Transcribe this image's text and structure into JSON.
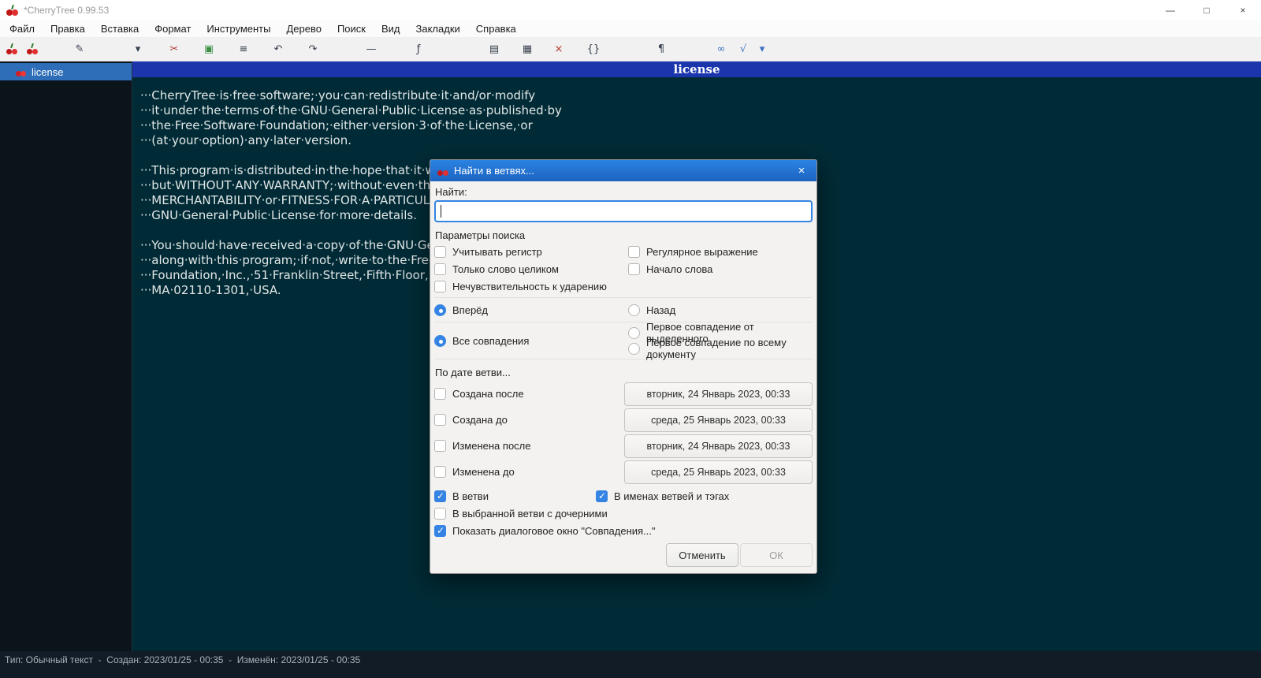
{
  "colors": {
    "accent": "#3584e4",
    "tree_selection": "#2e6db8",
    "node_header": "#1b35ad",
    "editor_background": "#002b36",
    "dialog_titlebar": "#2071cf",
    "cherry_red": "#c01818"
  },
  "window": {
    "title": "*CherryTree 0.99.53",
    "minimize": "—",
    "maximize": "□",
    "close": "×"
  },
  "menubar": {
    "items": [
      "Файл",
      "Правка",
      "Вставка",
      "Формат",
      "Инструменты",
      "Дерево",
      "Поиск",
      "Вид",
      "Закладки",
      "Справка"
    ]
  },
  "toolbar": {
    "icons": [
      {
        "name": "node-edit-icon",
        "glyph": "✎"
      },
      {
        "name": "node-nav-dropdown-icon",
        "glyph": "▾"
      },
      {
        "name": "cut-icon",
        "glyph": "✂"
      },
      {
        "name": "paste-icon",
        "glyph": "▣"
      },
      {
        "name": "list-icon",
        "glyph": "≡"
      },
      {
        "name": "undo-icon",
        "glyph": "↶"
      },
      {
        "name": "redo-icon",
        "glyph": "↷"
      },
      {
        "name": "hrule-icon",
        "glyph": "—"
      },
      {
        "name": "formula-icon",
        "glyph": "ƒ"
      },
      {
        "name": "table-icon",
        "glyph": "▤"
      },
      {
        "name": "image-icon",
        "glyph": "▦"
      },
      {
        "name": "clear-format-icon",
        "glyph": "×"
      },
      {
        "name": "codebox-icon",
        "glyph": "{}"
      },
      {
        "name": "pilcrow-icon",
        "glyph": "¶"
      },
      {
        "name": "link-icon",
        "glyph": "∞"
      },
      {
        "name": "math-icon",
        "glyph": "√"
      },
      {
        "name": "more-dropdown-icon",
        "glyph": "▾"
      }
    ]
  },
  "tree": {
    "items": [
      {
        "label": "license",
        "selected": true
      }
    ]
  },
  "editor": {
    "node_title": "license",
    "lines": [
      "···CherryTree·is·free·software;·you·can·redistribute·it·and/or·modify",
      "···it·under·the·terms·of·the·GNU·General·Public·License·as·published·by",
      "···the·Free·Software·Foundation;·either·version·3·of·the·License,·or",
      "···(at·your·option)·any·later·version.",
      "",
      "···This·program·is·distributed·in·the·hope·that·it·will·be·useful,",
      "···but·WITHOUT·ANY·WARRANTY;·without·even·the·implied·warranty·of",
      "···MERCHANTABILITY·or·FITNESS·FOR·A·PARTICULAR·PURPOSE.··See·the",
      "···GNU·General·Public·License·for·more·details.",
      "",
      "···You·should·have·received·a·copy·of·the·GNU·General·Public·License",
      "···along·with·this·program;·if·not,·write·to·the·Free·Software",
      "···Foundation,·Inc.,·51·Franklin·Street,·Fifth·Floor,·Boston,",
      "···MA·02110-1301,·USA."
    ]
  },
  "dialog": {
    "title": "Найти в ветвях...",
    "close": "×",
    "search_label": "Найти:",
    "search_value": "",
    "params_label": "Параметры поиска",
    "date_label": "По дате ветви...",
    "checkboxes": {
      "match_case": {
        "label": "Учитывать регистр",
        "checked": false
      },
      "regexp": {
        "label": "Регулярное выражение",
        "checked": false
      },
      "whole_word": {
        "label": "Только слово целиком",
        "checked": false
      },
      "word_start": {
        "label": "Начало слова",
        "checked": false
      },
      "accent_insensitive": {
        "label": "Нечувствительность к ударению",
        "checked": false
      }
    },
    "radios": {
      "forward": {
        "label": "Вперёд",
        "selected": true
      },
      "backward": {
        "label": "Назад",
        "selected": false
      },
      "all_matches": {
        "label": "Все совпадения",
        "selected": true
      },
      "first_from_selection": {
        "label": "Первое совпадение от выделенного",
        "selected": false
      },
      "first_in_document": {
        "label": "Первое совпадение по всему документу",
        "selected": false
      }
    },
    "date_filters": [
      {
        "label": "Создана после",
        "checked": false,
        "value": "вторник, 24 Январь 2023, 00:33"
      },
      {
        "label": "Создана до",
        "checked": false,
        "value": "среда, 25 Январь 2023, 00:33"
      },
      {
        "label": "Изменена после",
        "checked": false,
        "value": "вторник, 24 Январь 2023, 00:33"
      },
      {
        "label": "Изменена до",
        "checked": false,
        "value": "среда, 25 Январь 2023, 00:33"
      }
    ],
    "scope": {
      "in_node": {
        "label": "В ветви",
        "checked": true
      },
      "in_names_tags": {
        "label": "В именах ветвей и тэгах",
        "checked": true
      },
      "in_selected_with_children": {
        "label": "В выбранной ветви с дочерними",
        "checked": false
      },
      "show_matches_dialog": {
        "label": "Показать диалоговое окно \"Совпадения...\"",
        "checked": true
      }
    },
    "buttons": {
      "cancel": "Отменить",
      "ok": "ОК"
    }
  },
  "statusbar": {
    "text": "Тип: Обычный текст  -  Создан: 2023/01/25 - 00:35  -  Изменён: 2023/01/25 - 00:35"
  }
}
